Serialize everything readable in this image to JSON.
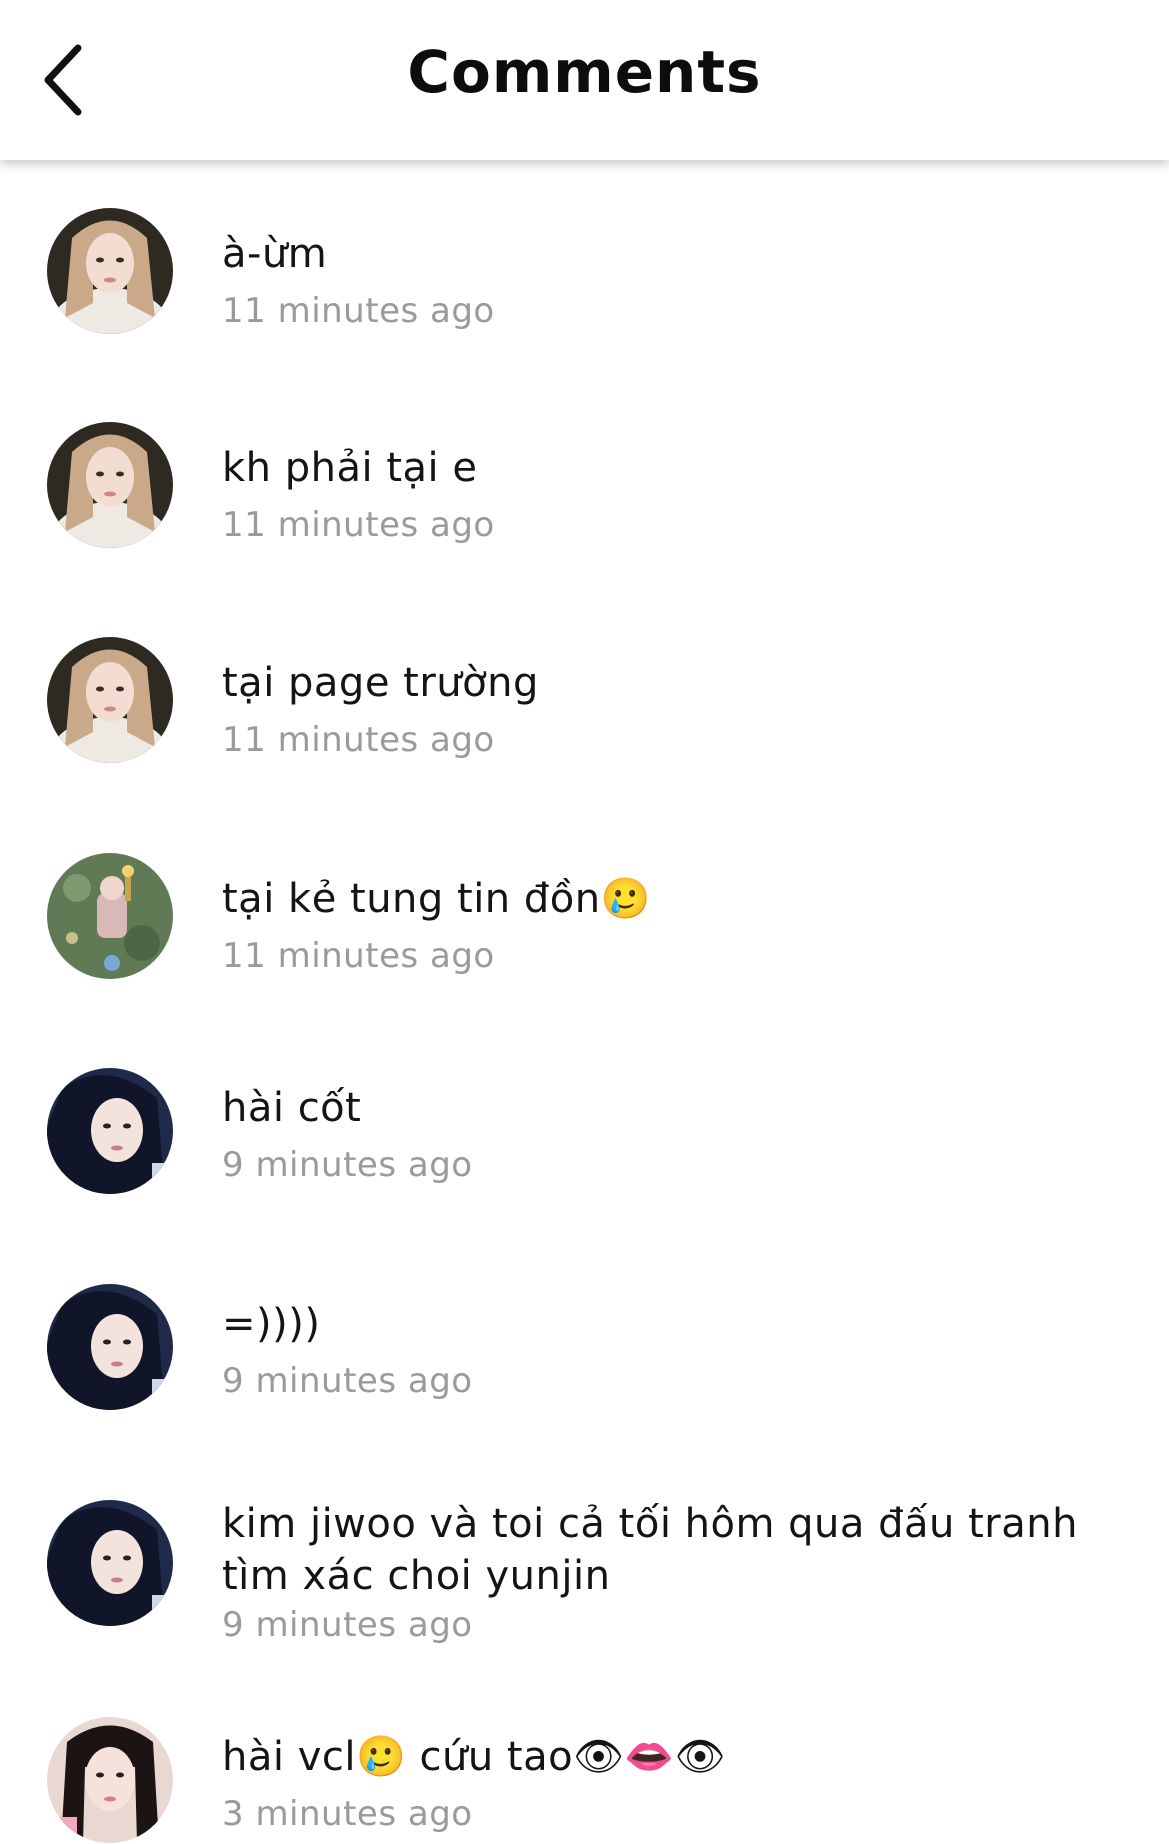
{
  "header": {
    "title": "Comments",
    "back_icon": "chevron-left-icon"
  },
  "comments": [
    {
      "text": "à-ừm",
      "time": "11 minutes ago",
      "avatar": "avatar-blonde"
    },
    {
      "text": "kh phải tại e",
      "time": "11 minutes ago",
      "avatar": "avatar-blonde"
    },
    {
      "text": "tại page trường",
      "time": "11 minutes ago",
      "avatar": "avatar-blonde"
    },
    {
      "text": "tại kẻ tung tin đồn🥲",
      "time": "11 minutes ago",
      "avatar": "avatar-illustration"
    },
    {
      "text": "hài cốt",
      "time": "9 minutes ago",
      "avatar": "avatar-darkhair"
    },
    {
      "text": "=))))",
      "time": "9 minutes ago",
      "avatar": "avatar-darkhair"
    },
    {
      "text": "kim jiwoo và toi cả tối hôm qua đấu tranh tìm xác choi yunjin",
      "time": "9 minutes ago",
      "avatar": "avatar-darkhair"
    },
    {
      "text": "hài vcl🥲 cứu tao👁👄👁",
      "time": "3 minutes ago",
      "avatar": "avatar-pink"
    }
  ]
}
